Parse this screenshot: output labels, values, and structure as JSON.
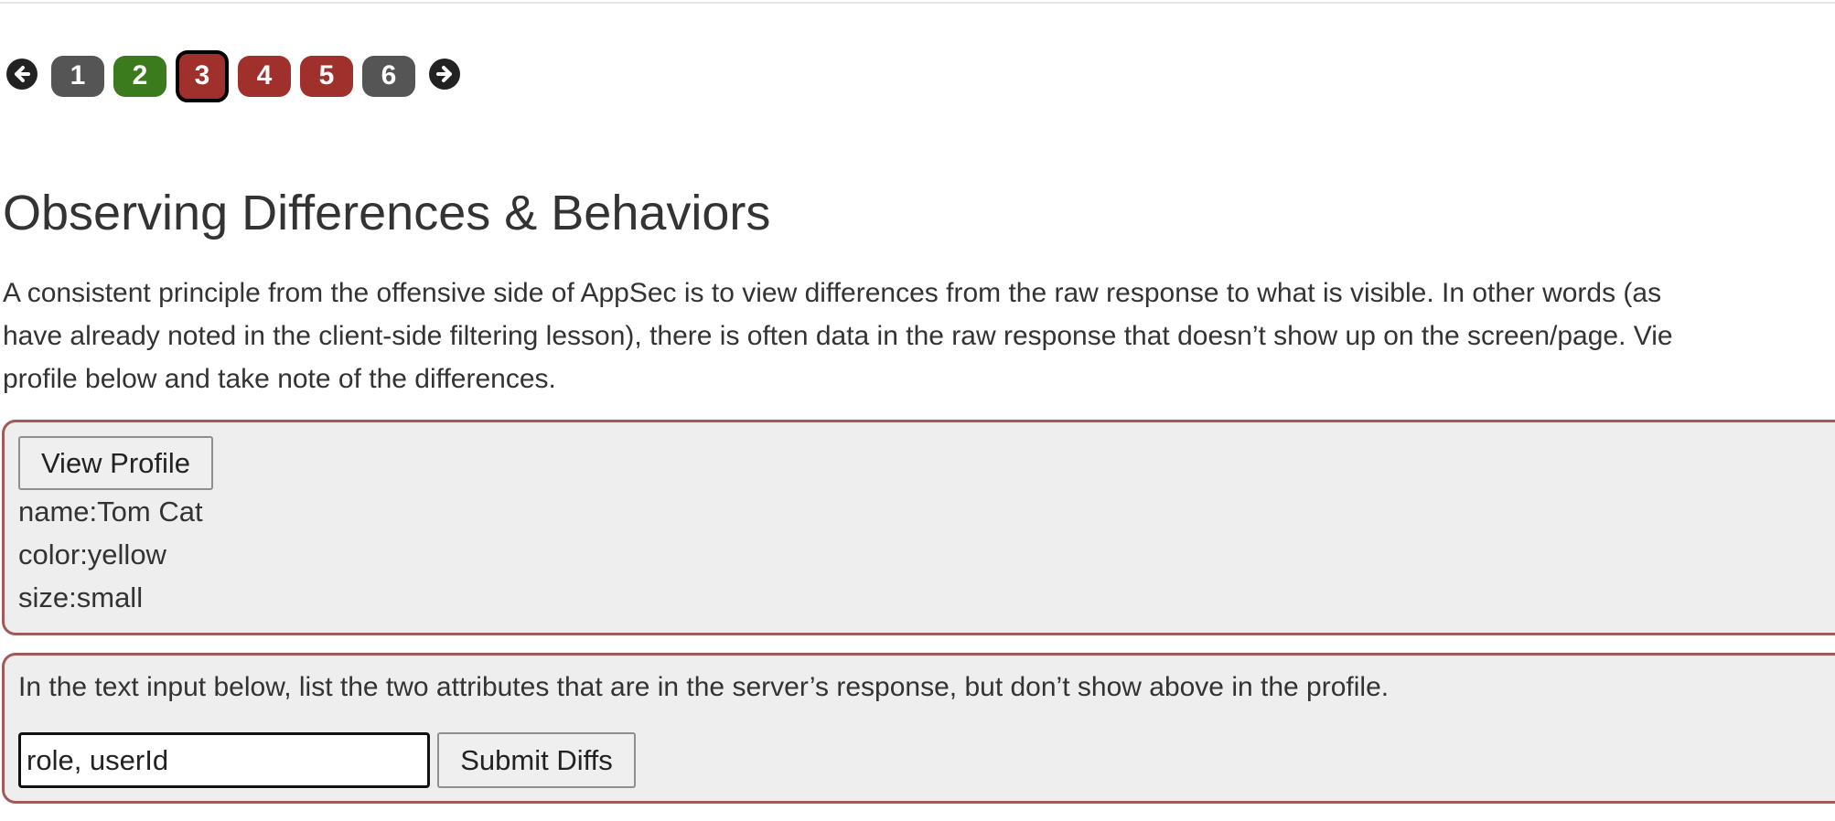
{
  "pagination": {
    "prev_icon": "arrow-left-icon",
    "next_icon": "arrow-right-icon",
    "pages": [
      {
        "label": "1",
        "state": "grey",
        "color": "#555555"
      },
      {
        "label": "2",
        "state": "green",
        "color": "#3c7a1e"
      },
      {
        "label": "3",
        "state": "red-current",
        "color": "#a0302c"
      },
      {
        "label": "4",
        "state": "red",
        "color": "#a0302c"
      },
      {
        "label": "5",
        "state": "red",
        "color": "#a0302c"
      },
      {
        "label": "6",
        "state": "grey",
        "color": "#555555"
      }
    ],
    "current_page": "3"
  },
  "lesson": {
    "title": "Observing Differences & Behaviors",
    "intro_lines": [
      "A consistent principle from the offensive side of AppSec is to view differences from the raw response to what is visible. In other words (as",
      "have already noted in the client-side filtering lesson), there is often data in the raw response that doesn’t show up on the screen/page. Vie",
      "profile below and take note of the differences."
    ]
  },
  "profile_panel": {
    "view_button_label": "View Profile",
    "fields": [
      "name:Tom Cat",
      "color:yellow",
      "size:small"
    ]
  },
  "diffs_panel": {
    "prompt": "In the text input below, list the two attributes that are in the server’s response, but don’t show above in the profile.",
    "input_value": "role, userId",
    "submit_label": "Submit Diffs"
  },
  "colors": {
    "panel_border": "#a05a5a",
    "panel_background": "#eeeeee"
  }
}
